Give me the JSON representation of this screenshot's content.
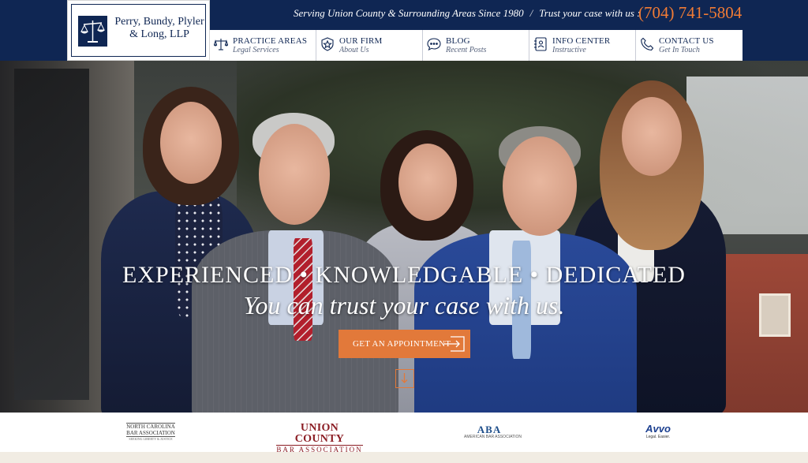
{
  "header": {
    "logo_line1": "Perry, Bundy, Plyler",
    "logo_line2": "& Long, LLP",
    "tagline": "Serving Union County & Surrounding Areas Since 1980",
    "tagline_separator": "/",
    "tagline_cta": "Trust your case with us :",
    "phone": "(704) 741-5804",
    "colors": {
      "navy": "#0f2653",
      "orange": "#f07b35"
    }
  },
  "nav": {
    "items": [
      {
        "title": "PRACTICE AREAS",
        "subtitle": "Legal Services",
        "icon": "scales-icon"
      },
      {
        "title": "OUR FIRM",
        "subtitle": "About Us",
        "icon": "badge-icon"
      },
      {
        "title": "BLOG",
        "subtitle": "Recent Posts",
        "icon": "chat-bubble-icon"
      },
      {
        "title": "INFO CENTER",
        "subtitle": "Instructive",
        "icon": "contact-book-icon"
      },
      {
        "title": "CONTACT US",
        "subtitle": "Get In Touch",
        "icon": "phone-icon"
      }
    ]
  },
  "hero": {
    "headline": "EXPERIENCED • KNOWLEDGABLE • DEDICATED",
    "subheadline": "You can trust your case with us.",
    "cta_label": "GET AN APPOINTMENT",
    "cta_color": "#e2793a"
  },
  "partners": {
    "ncba_line1": "NORTH CAROLINA",
    "ncba_line2": "BAR ASSOCIATION",
    "ncba_line3": "SEEKING LIBERTY & JUSTICE",
    "ucba_line1": "UNION COUNTY",
    "ucba_line2": "BAR ASSOCIATION",
    "aba_line1": "ABA",
    "aba_line2": "AMERICAN BAR ASSOCIATION",
    "avvo_line1": "Avvo",
    "avvo_line2": "Legal. Easier."
  }
}
